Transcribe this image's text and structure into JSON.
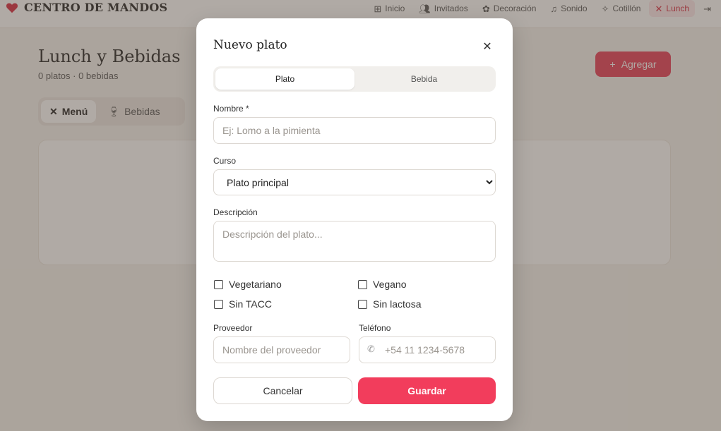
{
  "app": {
    "brand_title": "CENTRO DE MANDOS",
    "nav": [
      {
        "label": "Inicio",
        "icon": "grid-icon"
      },
      {
        "label": "Invitados",
        "icon": "users-icon"
      },
      {
        "label": "Decoración",
        "icon": "flower-icon"
      },
      {
        "label": "Sonido",
        "icon": "music-icon"
      },
      {
        "label": "Cotillón",
        "icon": "sparkles-icon"
      },
      {
        "label": "Lunch",
        "icon": "utensils-icon",
        "active": true
      }
    ],
    "logout_icon": "logout-icon"
  },
  "page": {
    "title": "Lunch y Bebidas",
    "subtitle": "0 platos · 0 bebidas",
    "add_label": "Agregar",
    "tabs": [
      {
        "label": "Menú",
        "icon": "utensils-icon"
      },
      {
        "label": "Bebidas",
        "icon": "wine-icon"
      }
    ]
  },
  "modal": {
    "title": "Nuevo plato",
    "segments": [
      "Plato",
      "Bebida"
    ],
    "active_segment": "Plato",
    "name_label": "Nombre *",
    "name_placeholder": "Ej: Lomo a la pimienta",
    "course_label": "Curso",
    "course_value": "Plato principal",
    "description_label": "Descripción",
    "description_placeholder": "Descripción del plato...",
    "options": [
      "Vegetariano",
      "Vegano",
      "Sin TACC",
      "Sin lactosa"
    ],
    "provider_label": "Proveedor",
    "provider_placeholder": "Nombre del proveedor",
    "phone_label": "Teléfono",
    "phone_placeholder": "+54 11 1234-5678",
    "cancel_label": "Cancelar",
    "save_label": "Guardar"
  },
  "colors": {
    "accent": "#f23d5c",
    "active_nav_bg": "#fde8ec"
  }
}
